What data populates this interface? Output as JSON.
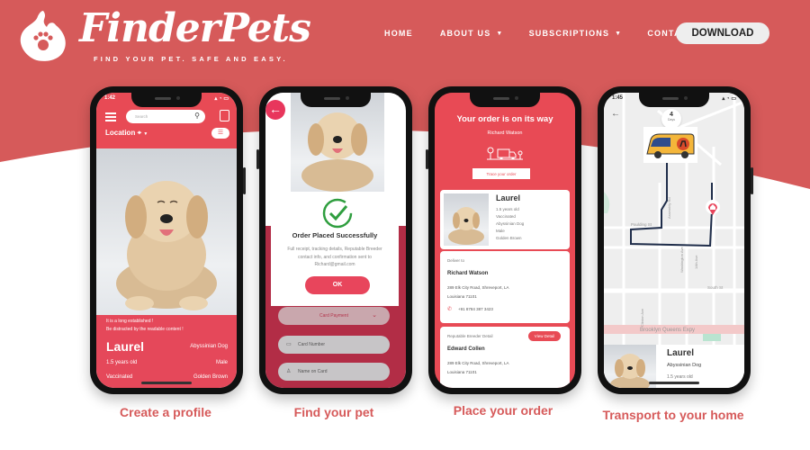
{
  "brand": {
    "name": "FinderPets",
    "tagline": "FIND YOUR PET. SAFE AND EASY.",
    "primary_color": "#d65a5a",
    "accent_color": "#e84a55"
  },
  "nav": {
    "items": [
      {
        "label": "HOME",
        "has_dropdown": false
      },
      {
        "label": "ABOUT US",
        "has_dropdown": true
      },
      {
        "label": "SUBSCRIPTIONS",
        "has_dropdown": true
      },
      {
        "label": "CONTACT",
        "has_dropdown": false
      }
    ],
    "download_label": "DOWNLOAD"
  },
  "phones": [
    {
      "caption": "Create a profile",
      "status_time": "1:42",
      "search_placeholder": "Search",
      "location_label": "Location",
      "message_lines": [
        "It is a long established !",
        "Be distracted by the readable content !"
      ],
      "pet": {
        "name": "Laurel",
        "breed": "Abyssinian Dog",
        "age": "1.5 years old",
        "sex": "Male",
        "status": "Vaccinated",
        "color": "Golden Brown"
      }
    },
    {
      "caption": "Find your pet",
      "title": "Order Placed Successfully",
      "description": "Full receipt, tracking details, Reputable Breeder contact info, and confirmation sent to Richard@gmail.com",
      "ok_label": "OK",
      "payment_select": "Card Payment",
      "card_number_placeholder": "Card Number",
      "name_on_card_placeholder": "Name on Card"
    },
    {
      "caption": "Place your order",
      "title": "Your order is on its way",
      "customer": "Richard Watson",
      "trace_label": "Trace your order",
      "pet": {
        "name": "Laurel",
        "details": [
          "1.5 years old",
          "Vaccinated",
          "Abyssinian Dog",
          "Male",
          "Golden Brown"
        ]
      },
      "deliver_to_label": "Deliver to",
      "deliver_name": "Richard Watson",
      "address_line1": "289  Elk City Road, Shreveport, LA",
      "address_line2": "Louisiana 71101",
      "phone": "+91 8784 387 3423",
      "breeder_label": "Reputable Breeder Detail",
      "view_detail_label": "View Detail",
      "breeder_name": "Edward Collen",
      "breeder_address_line1": "289  Elk City Road, Shreveport, LA",
      "breeder_address_line2": "Louisiana 71101"
    },
    {
      "caption": "Transport to your home",
      "status_time": "1:45",
      "eta_value": "4",
      "eta_unit": "Days",
      "streets": [
        "Paulding St",
        "South St",
        "Brooklyn Queens Expy",
        "Washington Ave",
        "14th Ave",
        "Assembly Rd",
        "Clinton Ave"
      ],
      "pet": {
        "name": "Laurel",
        "breed": "Abyssinian Dog",
        "age": "1.5 years old"
      }
    }
  ]
}
